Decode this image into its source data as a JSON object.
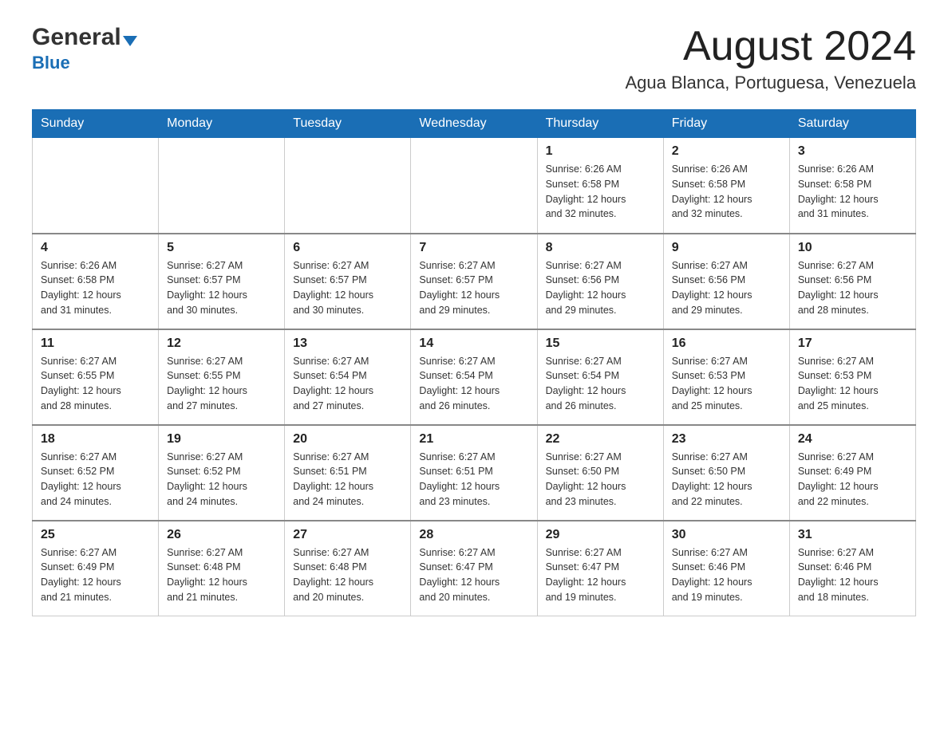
{
  "header": {
    "logo_main": "General",
    "logo_sub": "Blue",
    "month_title": "August 2024",
    "location": "Agua Blanca, Portuguesa, Venezuela"
  },
  "days_of_week": [
    "Sunday",
    "Monday",
    "Tuesday",
    "Wednesday",
    "Thursday",
    "Friday",
    "Saturday"
  ],
  "weeks": [
    [
      {
        "day": "",
        "info": ""
      },
      {
        "day": "",
        "info": ""
      },
      {
        "day": "",
        "info": ""
      },
      {
        "day": "",
        "info": ""
      },
      {
        "day": "1",
        "info": "Sunrise: 6:26 AM\nSunset: 6:58 PM\nDaylight: 12 hours\nand 32 minutes."
      },
      {
        "day": "2",
        "info": "Sunrise: 6:26 AM\nSunset: 6:58 PM\nDaylight: 12 hours\nand 32 minutes."
      },
      {
        "day": "3",
        "info": "Sunrise: 6:26 AM\nSunset: 6:58 PM\nDaylight: 12 hours\nand 31 minutes."
      }
    ],
    [
      {
        "day": "4",
        "info": "Sunrise: 6:26 AM\nSunset: 6:58 PM\nDaylight: 12 hours\nand 31 minutes."
      },
      {
        "day": "5",
        "info": "Sunrise: 6:27 AM\nSunset: 6:57 PM\nDaylight: 12 hours\nand 30 minutes."
      },
      {
        "day": "6",
        "info": "Sunrise: 6:27 AM\nSunset: 6:57 PM\nDaylight: 12 hours\nand 30 minutes."
      },
      {
        "day": "7",
        "info": "Sunrise: 6:27 AM\nSunset: 6:57 PM\nDaylight: 12 hours\nand 29 minutes."
      },
      {
        "day": "8",
        "info": "Sunrise: 6:27 AM\nSunset: 6:56 PM\nDaylight: 12 hours\nand 29 minutes."
      },
      {
        "day": "9",
        "info": "Sunrise: 6:27 AM\nSunset: 6:56 PM\nDaylight: 12 hours\nand 29 minutes."
      },
      {
        "day": "10",
        "info": "Sunrise: 6:27 AM\nSunset: 6:56 PM\nDaylight: 12 hours\nand 28 minutes."
      }
    ],
    [
      {
        "day": "11",
        "info": "Sunrise: 6:27 AM\nSunset: 6:55 PM\nDaylight: 12 hours\nand 28 minutes."
      },
      {
        "day": "12",
        "info": "Sunrise: 6:27 AM\nSunset: 6:55 PM\nDaylight: 12 hours\nand 27 minutes."
      },
      {
        "day": "13",
        "info": "Sunrise: 6:27 AM\nSunset: 6:54 PM\nDaylight: 12 hours\nand 27 minutes."
      },
      {
        "day": "14",
        "info": "Sunrise: 6:27 AM\nSunset: 6:54 PM\nDaylight: 12 hours\nand 26 minutes."
      },
      {
        "day": "15",
        "info": "Sunrise: 6:27 AM\nSunset: 6:54 PM\nDaylight: 12 hours\nand 26 minutes."
      },
      {
        "day": "16",
        "info": "Sunrise: 6:27 AM\nSunset: 6:53 PM\nDaylight: 12 hours\nand 25 minutes."
      },
      {
        "day": "17",
        "info": "Sunrise: 6:27 AM\nSunset: 6:53 PM\nDaylight: 12 hours\nand 25 minutes."
      }
    ],
    [
      {
        "day": "18",
        "info": "Sunrise: 6:27 AM\nSunset: 6:52 PM\nDaylight: 12 hours\nand 24 minutes."
      },
      {
        "day": "19",
        "info": "Sunrise: 6:27 AM\nSunset: 6:52 PM\nDaylight: 12 hours\nand 24 minutes."
      },
      {
        "day": "20",
        "info": "Sunrise: 6:27 AM\nSunset: 6:51 PM\nDaylight: 12 hours\nand 24 minutes."
      },
      {
        "day": "21",
        "info": "Sunrise: 6:27 AM\nSunset: 6:51 PM\nDaylight: 12 hours\nand 23 minutes."
      },
      {
        "day": "22",
        "info": "Sunrise: 6:27 AM\nSunset: 6:50 PM\nDaylight: 12 hours\nand 23 minutes."
      },
      {
        "day": "23",
        "info": "Sunrise: 6:27 AM\nSunset: 6:50 PM\nDaylight: 12 hours\nand 22 minutes."
      },
      {
        "day": "24",
        "info": "Sunrise: 6:27 AM\nSunset: 6:49 PM\nDaylight: 12 hours\nand 22 minutes."
      }
    ],
    [
      {
        "day": "25",
        "info": "Sunrise: 6:27 AM\nSunset: 6:49 PM\nDaylight: 12 hours\nand 21 minutes."
      },
      {
        "day": "26",
        "info": "Sunrise: 6:27 AM\nSunset: 6:48 PM\nDaylight: 12 hours\nand 21 minutes."
      },
      {
        "day": "27",
        "info": "Sunrise: 6:27 AM\nSunset: 6:48 PM\nDaylight: 12 hours\nand 20 minutes."
      },
      {
        "day": "28",
        "info": "Sunrise: 6:27 AM\nSunset: 6:47 PM\nDaylight: 12 hours\nand 20 minutes."
      },
      {
        "day": "29",
        "info": "Sunrise: 6:27 AM\nSunset: 6:47 PM\nDaylight: 12 hours\nand 19 minutes."
      },
      {
        "day": "30",
        "info": "Sunrise: 6:27 AM\nSunset: 6:46 PM\nDaylight: 12 hours\nand 19 minutes."
      },
      {
        "day": "31",
        "info": "Sunrise: 6:27 AM\nSunset: 6:46 PM\nDaylight: 12 hours\nand 18 minutes."
      }
    ]
  ]
}
